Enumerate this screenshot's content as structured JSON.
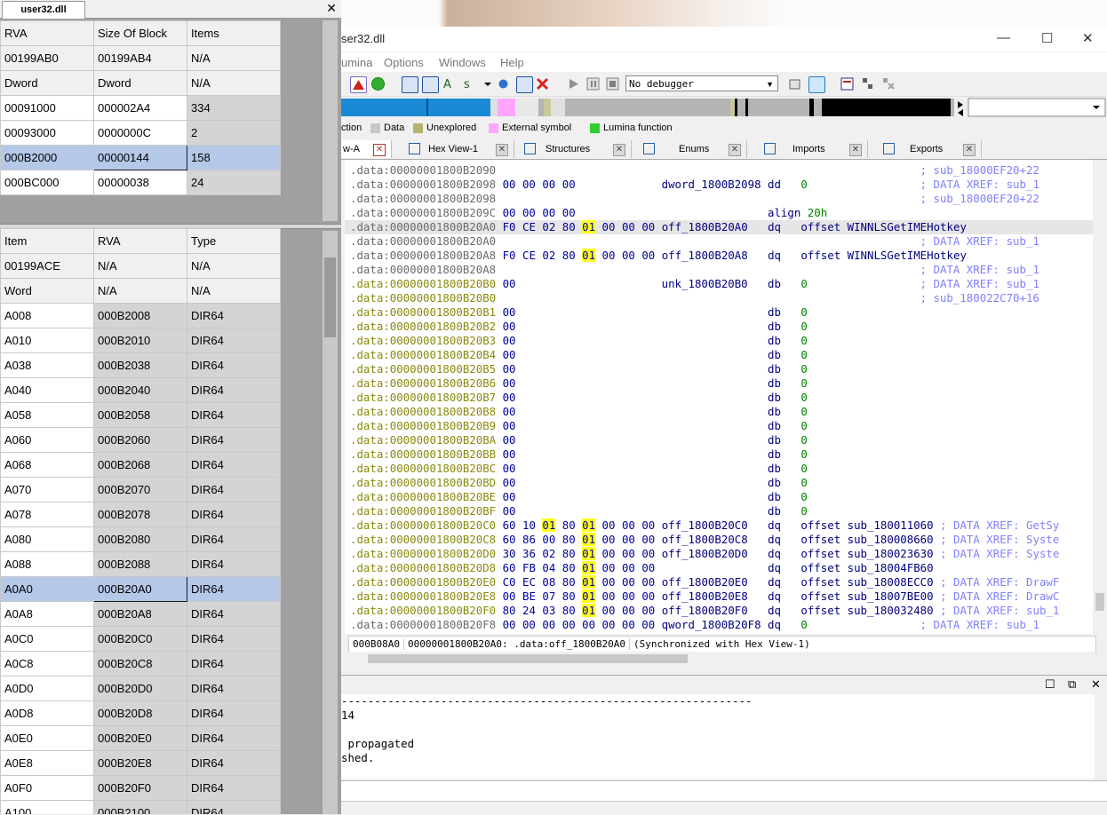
{
  "left_panel": {
    "tab_title": "user32.dll",
    "close_glyph": "✕",
    "table1": [
      [
        "RVA",
        "Size Of Block",
        "Items"
      ],
      [
        "00199AB0",
        "00199AB4",
        "N/A"
      ],
      [
        "Dword",
        "Dword",
        "N/A"
      ],
      [
        "00091000",
        "000002A4",
        "334"
      ],
      [
        "00093000",
        "0000000C",
        "2"
      ],
      [
        "000B2000",
        "00000144",
        "158"
      ],
      [
        "000BC000",
        "00000038",
        "24"
      ]
    ],
    "table2": [
      [
        "Item",
        "RVA",
        "Type"
      ],
      [
        "00199ACE",
        "N/A",
        "N/A"
      ],
      [
        "Word",
        "N/A",
        "N/A"
      ],
      [
        "A008",
        "000B2008",
        "DIR64"
      ],
      [
        "A010",
        "000B2010",
        "DIR64"
      ],
      [
        "A038",
        "000B2038",
        "DIR64"
      ],
      [
        "A040",
        "000B2040",
        "DIR64"
      ],
      [
        "A058",
        "000B2058",
        "DIR64"
      ],
      [
        "A060",
        "000B2060",
        "DIR64"
      ],
      [
        "A068",
        "000B2068",
        "DIR64"
      ],
      [
        "A070",
        "000B2070",
        "DIR64"
      ],
      [
        "A078",
        "000B2078",
        "DIR64"
      ],
      [
        "A080",
        "000B2080",
        "DIR64"
      ],
      [
        "A088",
        "000B2088",
        "DIR64"
      ],
      [
        "A0A0",
        "000B20A0",
        "DIR64"
      ],
      [
        "A0A8",
        "000B20A8",
        "DIR64"
      ],
      [
        "A0C0",
        "000B20C0",
        "DIR64"
      ],
      [
        "A0C8",
        "000B20C8",
        "DIR64"
      ],
      [
        "A0D0",
        "000B20D0",
        "DIR64"
      ],
      [
        "A0D8",
        "000B20D8",
        "DIR64"
      ],
      [
        "A0E0",
        "000B20E0",
        "DIR64"
      ],
      [
        "A0E8",
        "000B20E8",
        "DIR64"
      ],
      [
        "A0F0",
        "000B20F0",
        "DIR64"
      ],
      [
        "A100",
        "000B2100",
        "DIR64"
      ]
    ]
  },
  "ida": {
    "title": "ser32.dll",
    "win_min": "—",
    "win_max": "☐",
    "win_close": "✕",
    "menus": [
      "umina",
      "Options",
      "Windows",
      "Help"
    ],
    "debugger_select": "No debugger",
    "dropdown_glyph": "▼",
    "legend": [
      {
        "label": "ction",
        "color": ""
      },
      {
        "label": "Data",
        "color": "#c8c8c8"
      },
      {
        "label": "Unexplored",
        "color": "#b4b470"
      },
      {
        "label": "External symbol",
        "color": "#ffa6ff"
      },
      {
        "label": "Lumina function",
        "color": "#30d030"
      }
    ],
    "tabs": [
      {
        "label": "w-A",
        "close": "✕"
      },
      {
        "label": "Hex View-1",
        "close": "✕"
      },
      {
        "label": "Structures",
        "close": "✕"
      },
      {
        "label": "Enums",
        "close": "✕"
      },
      {
        "label": "Imports",
        "close": "✕"
      },
      {
        "label": "Exports",
        "close": "✕"
      }
    ],
    "disasm": [
      {
        "addr": ".data:00000001800B2090",
        "bytes": "",
        "name": "",
        "op": "",
        "arg": "",
        "cmt": "; sub_18000EF20+22"
      },
      {
        "addr": ".data:00000001800B2098",
        "bytes": "00 00 00 00",
        "name": "dword_1800B2098",
        "op": "dd",
        "arg": "0",
        "cmt": "; DATA XREF: sub_1"
      },
      {
        "addr": ".data:00000001800B2098",
        "bytes": "",
        "name": "",
        "op": "",
        "arg": "",
        "cmt": "; sub_18000EF20+22"
      },
      {
        "addr": ".data:00000001800B209C",
        "bytes": "00 00 00 00",
        "name": "",
        "op": "align",
        "arg": "20h",
        "cmt": ""
      },
      {
        "addr": ".data:00000001800B20A0",
        "bytes": "F0 CE 02 80 01 00 00 00",
        "name": "off_1800B20A0",
        "op": "dq",
        "arg": "offset WINNLSGetIMEHotkey",
        "cmt": ""
      },
      {
        "addr": ".data:00000001800B20A0",
        "bytes": "",
        "name": "",
        "op": "",
        "arg": "",
        "cmt": "; DATA XREF: sub_1"
      },
      {
        "addr": ".data:00000001800B20A8",
        "bytes": "F0 CE 02 80 01 00 00 00",
        "name": "off_1800B20A8",
        "op": "dq",
        "arg": "offset WINNLSGetIMEHotkey",
        "cmt": ""
      },
      {
        "addr": ".data:00000001800B20A8",
        "bytes": "",
        "name": "",
        "op": "",
        "arg": "",
        "cmt": "; DATA XREF: sub_1"
      },
      {
        "addr": ".data:00000001800B20B0",
        "bytes": "00",
        "name": "unk_1800B20B0",
        "op": "db",
        "arg": "0",
        "cmt": "; DATA XREF: sub_1"
      },
      {
        "addr": ".data:00000001800B20B0",
        "bytes": "",
        "name": "",
        "op": "",
        "arg": "",
        "cmt": "; sub_180022C70+16"
      },
      {
        "addr": ".data:00000001800B20B1",
        "bytes": "00",
        "name": "",
        "op": "db",
        "arg": "0",
        "cmt": ""
      },
      {
        "addr": ".data:00000001800B20B2",
        "bytes": "00",
        "name": "",
        "op": "db",
        "arg": "0",
        "cmt": ""
      },
      {
        "addr": ".data:00000001800B20B3",
        "bytes": "00",
        "name": "",
        "op": "db",
        "arg": "0",
        "cmt": ""
      },
      {
        "addr": ".data:00000001800B20B4",
        "bytes": "00",
        "name": "",
        "op": "db",
        "arg": "0",
        "cmt": ""
      },
      {
        "addr": ".data:00000001800B20B5",
        "bytes": "00",
        "name": "",
        "op": "db",
        "arg": "0",
        "cmt": ""
      },
      {
        "addr": ".data:00000001800B20B6",
        "bytes": "00",
        "name": "",
        "op": "db",
        "arg": "0",
        "cmt": ""
      },
      {
        "addr": ".data:00000001800B20B7",
        "bytes": "00",
        "name": "",
        "op": "db",
        "arg": "0",
        "cmt": ""
      },
      {
        "addr": ".data:00000001800B20B8",
        "bytes": "00",
        "name": "",
        "op": "db",
        "arg": "0",
        "cmt": ""
      },
      {
        "addr": ".data:00000001800B20B9",
        "bytes": "00",
        "name": "",
        "op": "db",
        "arg": "0",
        "cmt": ""
      },
      {
        "addr": ".data:00000001800B20BA",
        "bytes": "00",
        "name": "",
        "op": "db",
        "arg": "0",
        "cmt": ""
      },
      {
        "addr": ".data:00000001800B20BB",
        "bytes": "00",
        "name": "",
        "op": "db",
        "arg": "0",
        "cmt": ""
      },
      {
        "addr": ".data:00000001800B20BC",
        "bytes": "00",
        "name": "",
        "op": "db",
        "arg": "0",
        "cmt": ""
      },
      {
        "addr": ".data:00000001800B20BD",
        "bytes": "00",
        "name": "",
        "op": "db",
        "arg": "0",
        "cmt": ""
      },
      {
        "addr": ".data:00000001800B20BE",
        "bytes": "00",
        "name": "",
        "op": "db",
        "arg": "0",
        "cmt": ""
      },
      {
        "addr": ".data:00000001800B20BF",
        "bytes": "00",
        "name": "",
        "op": "db",
        "arg": "0",
        "cmt": ""
      },
      {
        "addr": ".data:00000001800B20C0",
        "bytes": "60 10 01 80 01 00 00 00",
        "name": "off_1800B20C0",
        "op": "dq",
        "arg": "offset sub_180011060",
        "cmt": "; DATA XREF: GetSy"
      },
      {
        "addr": ".data:00000001800B20C8",
        "bytes": "60 86 00 80 01 00 00 00",
        "name": "off_1800B20C8",
        "op": "dq",
        "arg": "offset sub_180008660",
        "cmt": "; DATA XREF: Syste"
      },
      {
        "addr": ".data:00000001800B20D0",
        "bytes": "30 36 02 80 01 00 00 00",
        "name": "off_1800B20D0",
        "op": "dq",
        "arg": "offset sub_180023630",
        "cmt": "; DATA XREF: Syste"
      },
      {
        "addr": ".data:00000001800B20D8",
        "bytes": "60 FB 04 80 01 00 00 00",
        "name": "",
        "op": "dq",
        "arg": "offset sub_18004FB60",
        "cmt": ""
      },
      {
        "addr": ".data:00000001800B20E0",
        "bytes": "C0 EC 08 80 01 00 00 00",
        "name": "off_1800B20E0",
        "op": "dq",
        "arg": "offset sub_18008ECC0",
        "cmt": "; DATA XREF: DrawF"
      },
      {
        "addr": ".data:00000001800B20E8",
        "bytes": "00 BE 07 80 01 00 00 00",
        "name": "off_1800B20E8",
        "op": "dq",
        "arg": "offset sub_18007BE00",
        "cmt": "; DATA XREF: DrawC"
      },
      {
        "addr": ".data:00000001800B20F0",
        "bytes": "80 24 03 80 01 00 00 00",
        "name": "off_1800B20F0",
        "op": "dq",
        "arg": "offset sub_180032480",
        "cmt": "; DATA XREF: sub_1"
      },
      {
        "addr": ".data:00000001800B20F8",
        "bytes": "00 00 00 00 00 00 00 00",
        "name": "qword_1800B20F8",
        "op": "dq",
        "arg": "0",
        "cmt": "; DATA XREF: sub_1"
      }
    ],
    "status": {
      "offset": "000B08A0",
      "location": "00000001800B20A0: .data:off_1800B20A0",
      "sync": "(Synchronized with Hex View-1)"
    },
    "output": {
      "separator": "--------------------------------------------------------------",
      "lines": [
        "14",
        "",
        " propagated",
        "shed."
      ]
    },
    "output_ctl": [
      "☐",
      "⧉",
      "✕"
    ]
  }
}
